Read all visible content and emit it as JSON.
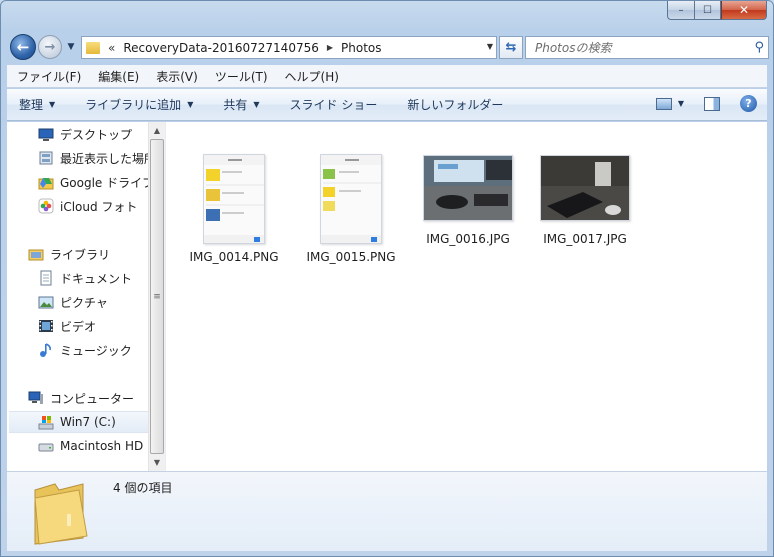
{
  "window": {
    "controls": {
      "minimize": "–",
      "maximize": "☐",
      "close": "✕"
    }
  },
  "nav": {
    "chevron": "«",
    "breadcrumb": [
      "RecoveryData-20160727140756",
      "Photos"
    ],
    "search_placeholder": "Photosの検索"
  },
  "menu": [
    "ファイル(F)",
    "編集(E)",
    "表示(V)",
    "ツール(T)",
    "ヘルプ(H)"
  ],
  "toolbar": {
    "organize": "整理",
    "include_library": "ライブラリに追加",
    "share": "共有",
    "slideshow": "スライド ショー",
    "new_folder": "新しいフォルダー"
  },
  "sidebar": {
    "favorites": [
      {
        "label": "デスクトップ",
        "icon": "desktop-icon"
      },
      {
        "label": "最近表示した場所",
        "icon": "recent-places-icon"
      },
      {
        "label": "Google ドライブ",
        "icon": "google-drive-icon"
      },
      {
        "label": "iCloud フォト",
        "icon": "icloud-photos-icon"
      }
    ],
    "libraries_label": "ライブラリ",
    "libraries": [
      {
        "label": "ドキュメント",
        "icon": "documents-icon"
      },
      {
        "label": "ピクチャ",
        "icon": "pictures-icon"
      },
      {
        "label": "ビデオ",
        "icon": "videos-icon"
      },
      {
        "label": "ミュージック",
        "icon": "music-icon"
      }
    ],
    "computer_label": "コンピューター",
    "drives": [
      {
        "label": "Win7 (C:)",
        "icon": "windows-drive-icon",
        "selected": true
      },
      {
        "label": "Macintosh HD (",
        "icon": "hard-drive-icon"
      }
    ]
  },
  "files": [
    {
      "name": "IMG_0014.PNG",
      "kind": "phone-screenshot"
    },
    {
      "name": "IMG_0015.PNG",
      "kind": "phone-screenshot"
    },
    {
      "name": "IMG_0016.JPG",
      "kind": "photo-desk"
    },
    {
      "name": "IMG_0017.JPG",
      "kind": "photo-desk"
    }
  ],
  "status": {
    "item_count": "4 個の項目"
  }
}
